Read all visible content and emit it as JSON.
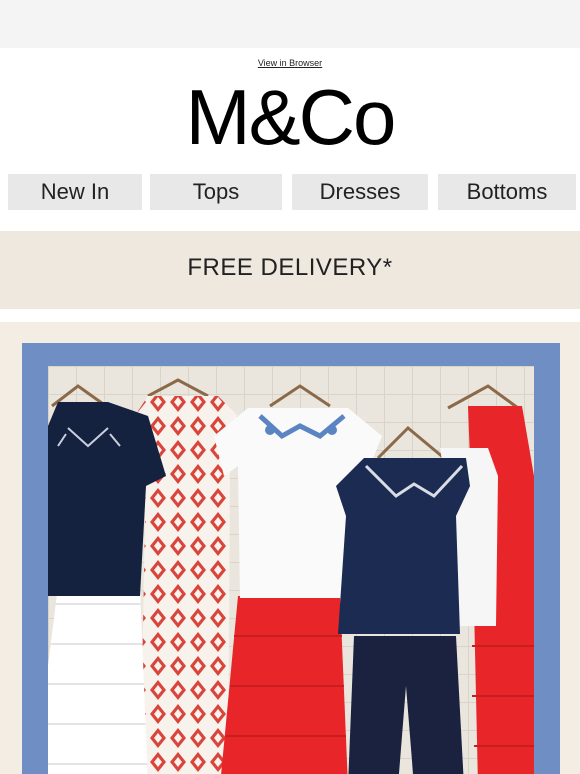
{
  "header": {
    "view_in_browser": "View in Browser",
    "logo_text": "M&Co"
  },
  "nav": {
    "items": [
      "New In",
      "Tops",
      "Dresses",
      "Bottoms"
    ]
  },
  "banner": {
    "text": "FREE DELIVERY*"
  },
  "colors": {
    "nav_bg": "#e8e8e8",
    "banner_bg": "#efe8df",
    "frame_blue": "#6f8fc4",
    "navy": "#14213f",
    "red": "#e8262a"
  }
}
